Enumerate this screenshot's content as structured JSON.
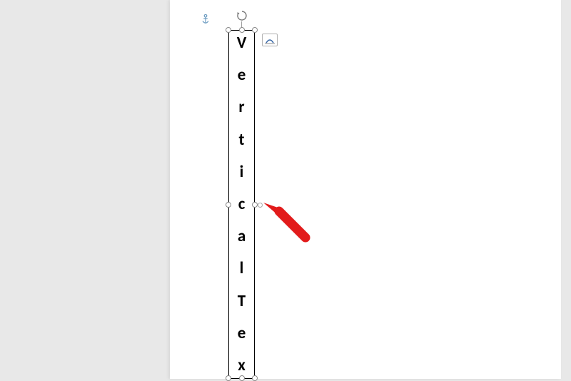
{
  "textbox": {
    "chars": [
      "V",
      "e",
      "r",
      "t",
      "i",
      "c",
      "a",
      "l",
      "T",
      "e",
      "x"
    ]
  },
  "icons": {
    "anchor": "anchor-icon",
    "rotate": "rotate-handle-icon",
    "layout": "layout-options-icon"
  },
  "annotation": {
    "arrow_color": "#e21b1b"
  }
}
